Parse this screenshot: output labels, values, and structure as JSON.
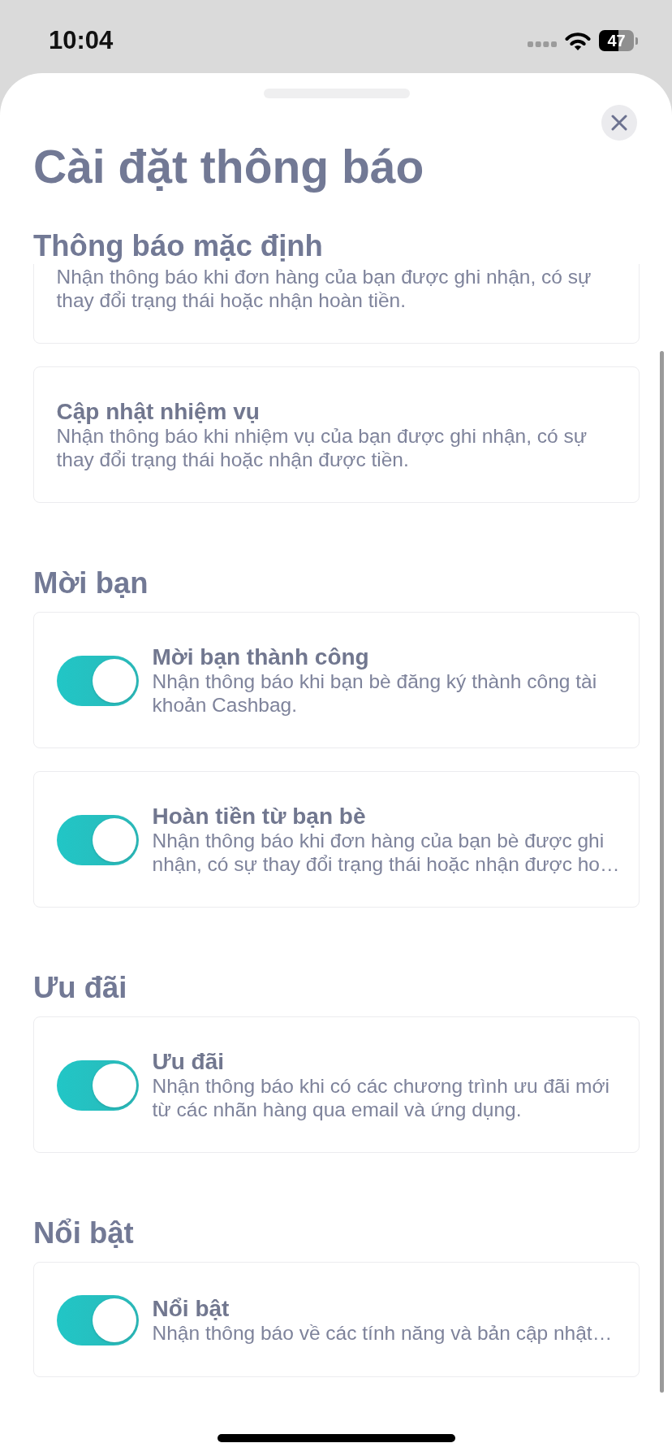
{
  "status_bar": {
    "time": "10:04",
    "battery": "47"
  },
  "sheet": {
    "title": "Cài đặt thông báo"
  },
  "sections": [
    {
      "title": "Thông báo mặc định",
      "items": [
        {
          "kind": "plain",
          "description": "Nhận thông báo khi đơn hàng của bạn được ghi nhận, có sự thay đổi trạng thái hoặc nhận hoàn tiền."
        },
        {
          "kind": "plain",
          "title": "Cập nhật nhiệm vụ",
          "description": "Nhận thông báo khi nhiệm vụ của bạn được ghi nhận, có sự thay đổi trạng thái hoặc nhận được tiền."
        }
      ]
    },
    {
      "title": "Mời bạn",
      "items": [
        {
          "kind": "toggle",
          "on": true,
          "title": "Mời bạn thành công",
          "description": "Nhận thông báo khi bạn bè đăng ký thành công tài khoản Cashbag."
        },
        {
          "kind": "toggle",
          "on": true,
          "title": "Hoàn tiền từ bạn bè",
          "description": "Nhận thông báo khi đơn hàng của bạn bè được ghi nhận, có sự thay đổi trạng thái hoặc nhận được ho…"
        }
      ]
    },
    {
      "title": "Ưu đãi",
      "items": [
        {
          "kind": "toggle",
          "on": true,
          "title": "Ưu đãi",
          "description": "Nhận thông báo khi có các chương trình ưu đãi mới từ các nhãn hàng qua email và ứng dụng."
        }
      ]
    },
    {
      "title": "Nổi bật",
      "items": [
        {
          "kind": "toggle",
          "on": true,
          "title": "Nổi bật",
          "description": "Nhận thông báo về các tính năng và bản cập nhật…"
        }
      ]
    }
  ]
}
